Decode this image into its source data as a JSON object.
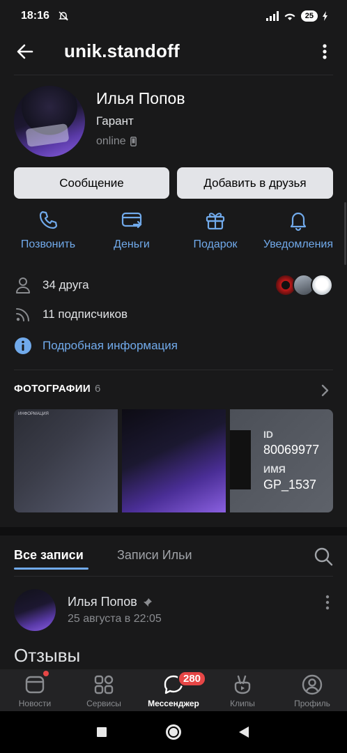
{
  "status_bar": {
    "time": "18:16",
    "battery": "25"
  },
  "header": {
    "title": "unik.standoff"
  },
  "profile": {
    "name": "Илья Попов",
    "status": "Гарант",
    "online": "online"
  },
  "buttons": {
    "message": "Сообщение",
    "add_friend": "Добавить в друзья"
  },
  "actions": [
    {
      "label": "Позвонить",
      "icon": "phone-icon"
    },
    {
      "label": "Деньги",
      "icon": "money-transfer-icon"
    },
    {
      "label": "Подарок",
      "icon": "gift-icon"
    },
    {
      "label": "Уведомления",
      "icon": "bell-icon"
    }
  ],
  "info": {
    "friends": "34 друга",
    "followers": "11 подписчиков",
    "details": "Подробная информация"
  },
  "photos": {
    "title": "ФОТОГРАФИИ",
    "count": "6",
    "card1_header": "ИНФОРМАЦИЯ",
    "card3_id_label": "ID",
    "card3_id_value": "80069977",
    "card3_name_label": "ИМЯ",
    "card3_name_value": "GP_1537"
  },
  "wall_tabs": {
    "all": "Все записи",
    "own": "Записи Ильи"
  },
  "post": {
    "author": "Илья Попов",
    "date": "25 августа в 22:05",
    "text": "Отзывы"
  },
  "tabbar": {
    "items": [
      {
        "label": "Новости",
        "icon": "news-icon"
      },
      {
        "label": "Сервисы",
        "icon": "services-icon"
      },
      {
        "label": "Мессенджер",
        "icon": "messenger-icon"
      },
      {
        "label": "Клипы",
        "icon": "clips-icon"
      },
      {
        "label": "Профиль",
        "icon": "profile-icon"
      }
    ],
    "messenger_badge": "280"
  },
  "colors": {
    "accent": "#71aaeb",
    "background": "#19191a",
    "badge": "#e64646"
  }
}
